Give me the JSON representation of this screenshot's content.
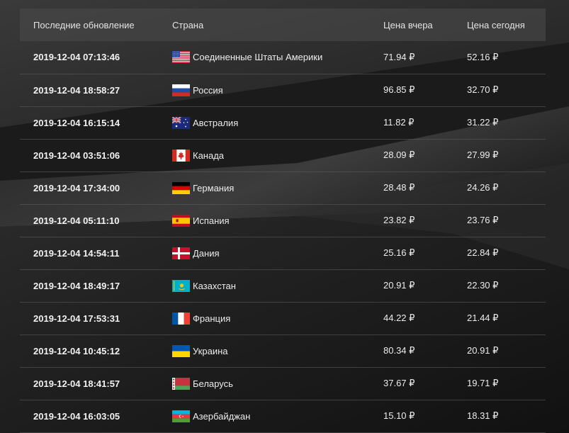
{
  "table": {
    "headers": {
      "updated": "Последние обновление",
      "country": "Страна",
      "price_yesterday": "Цена вчера",
      "price_today": "Цена сегодня"
    },
    "rows": [
      {
        "updated": "2019-12-04 07:13:46",
        "country": "Соединенные Штаты Америки",
        "flag": "us-flag-icon",
        "yesterday": "71.94 ₽",
        "today": "52.16 ₽"
      },
      {
        "updated": "2019-12-04 18:58:27",
        "country": "Россия",
        "flag": "ru-flag-icon",
        "yesterday": "96.85 ₽",
        "today": "32.70 ₽"
      },
      {
        "updated": "2019-12-04 16:15:14",
        "country": "Австралия",
        "flag": "au-flag-icon",
        "yesterday": "11.82 ₽",
        "today": "31.22 ₽"
      },
      {
        "updated": "2019-12-04 03:51:06",
        "country": "Канада",
        "flag": "ca-flag-icon",
        "yesterday": "28.09 ₽",
        "today": "27.99 ₽"
      },
      {
        "updated": "2019-12-04 17:34:00",
        "country": "Германия",
        "flag": "de-flag-icon",
        "yesterday": "28.48 ₽",
        "today": "24.26 ₽"
      },
      {
        "updated": "2019-12-04 05:11:10",
        "country": "Испания",
        "flag": "es-flag-icon",
        "yesterday": "23.82 ₽",
        "today": "23.76 ₽"
      },
      {
        "updated": "2019-12-04 14:54:11",
        "country": "Дания",
        "flag": "dk-flag-icon",
        "yesterday": "25.16 ₽",
        "today": "22.84 ₽"
      },
      {
        "updated": "2019-12-04 18:49:17",
        "country": "Казахстан",
        "flag": "kz-flag-icon",
        "yesterday": "20.91 ₽",
        "today": "22.30 ₽"
      },
      {
        "updated": "2019-12-04 17:53:31",
        "country": "Франция",
        "flag": "fr-flag-icon",
        "yesterday": "44.22 ₽",
        "today": "21.44 ₽"
      },
      {
        "updated": "2019-12-04 10:45:12",
        "country": "Украина",
        "flag": "ua-flag-icon",
        "yesterday": "80.34 ₽",
        "today": "20.91 ₽"
      },
      {
        "updated": "2019-12-04 18:41:57",
        "country": "Беларусь",
        "flag": "by-flag-icon",
        "yesterday": "37.67 ₽",
        "today": "19.71 ₽"
      },
      {
        "updated": "2019-12-04 16:03:05",
        "country": "Азербайджан",
        "flag": "az-flag-icon",
        "yesterday": "15.10 ₽",
        "today": "18.31 ₽"
      }
    ]
  },
  "colors": {
    "background": "#151515",
    "header_bg": "#4a4a4a",
    "text": "#ececec",
    "row_border": "#5f5f5f"
  }
}
